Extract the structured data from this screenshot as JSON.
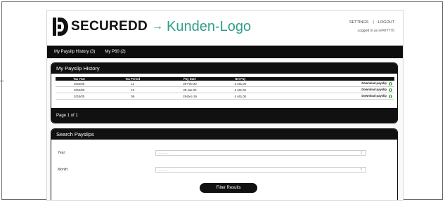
{
  "brand": {
    "name": "SECUREDD",
    "arrow": "→",
    "customer_logo": "Kunden-Logo",
    "logo_icon": "securedd-mark-icon"
  },
  "header": {
    "settings_label": "SETTINGS",
    "separator": "|",
    "logout_label": "LOGOUT",
    "logged_in_text": "Logged in as ref477770"
  },
  "nav": {
    "items": [
      {
        "label": "My Payslip History (3)"
      },
      {
        "label": "My P60 (2)"
      }
    ]
  },
  "history": {
    "title": "My Payslip History",
    "columns": [
      "Tax Year",
      "Tax Period",
      "Pay Date",
      "Net Pay",
      ""
    ],
    "rows": [
      {
        "tax_year": "2019/20",
        "tax_period": "11",
        "pay_date": "28-Feb-20",
        "net_pay": "£ 461.00",
        "action": "Download payslip"
      },
      {
        "tax_year": "2019/20",
        "tax_period": "10",
        "pay_date": "28-Jan-20",
        "net_pay": "£ 461.00",
        "action": "Download payslip"
      },
      {
        "tax_year": "2019/20",
        "tax_period": "09",
        "pay_date": "28-Dec-19",
        "net_pay": "£ 461.00",
        "action": "Download payslip"
      }
    ],
    "pager_text": "Page 1 of 1",
    "download_icon": "download-icon"
  },
  "search": {
    "title": "Search Payslips",
    "year_label": "Year:",
    "year_value": "---------",
    "month_label": "Month:",
    "month_value": "---------",
    "select_caret": "⇕",
    "filter_label": "Filter Results"
  },
  "colors": {
    "accent": "#2f9e8a",
    "bar": "#111111",
    "download": "#4caf50"
  }
}
